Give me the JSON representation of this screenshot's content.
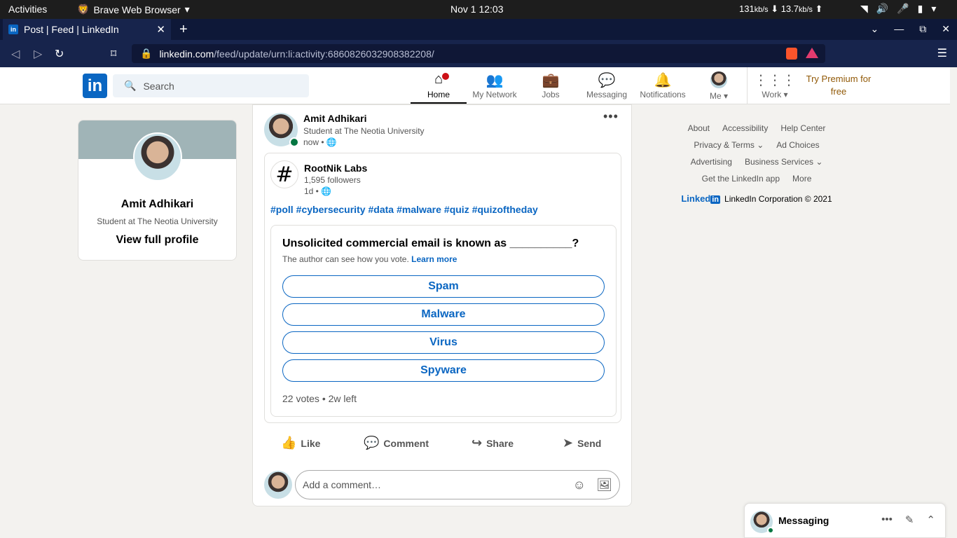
{
  "system": {
    "activities": "Activities",
    "app_name": "Brave Web Browser",
    "clock": "Nov 1  12:03",
    "down_speed": "131",
    "down_unit": "kb/s",
    "up_speed": "13.7",
    "up_unit": "kb/s"
  },
  "browser": {
    "tab_title": "Post | Feed | LinkedIn",
    "url_host": "linkedin.com",
    "url_path": "/feed/update/urn:li:activity:6860826032908382208/"
  },
  "linkedin": {
    "search_placeholder": "Search",
    "nav": {
      "home": "Home",
      "network": "My Network",
      "jobs": "Jobs",
      "messaging": "Messaging",
      "notifications": "Notifications",
      "me": "Me",
      "work": "Work"
    },
    "premium": "Try Premium for free"
  },
  "profile": {
    "name": "Amit Adhikari",
    "headline": "Student at The Neotia University",
    "view_profile": "View full profile"
  },
  "post": {
    "author": "Amit Adhikari",
    "headline": "Student at The Neotia University",
    "time": "now •",
    "shared": {
      "org": "RootNik Labs",
      "followers": "1,595 followers",
      "time": "1d •",
      "hashtags": [
        "#poll",
        "#cybersecurity",
        "#data",
        "#malware",
        "#quiz",
        "#quizoftheday"
      ],
      "poll": {
        "question": "Unsolicited commercial email is known as __________?",
        "note": "The author can see how you vote.",
        "learn_more": "Learn more",
        "options": [
          "Spam",
          "Malware",
          "Virus",
          "Spyware"
        ],
        "stats": "22 votes • 2w left"
      }
    },
    "actions": {
      "like": "Like",
      "comment": "Comment",
      "share": "Share",
      "send": "Send"
    },
    "comment_placeholder": "Add a comment…"
  },
  "footer": {
    "about": "About",
    "accessibility": "Accessibility",
    "help": "Help Center",
    "privacy": "Privacy & Terms",
    "ad_choices": "Ad Choices",
    "advertising": "Advertising",
    "business": "Business Services",
    "app": "Get the LinkedIn app",
    "more": "More",
    "brand": "Linked",
    "brand_in": "in",
    "copyright": "LinkedIn Corporation © 2021"
  },
  "messaging": {
    "title": "Messaging"
  },
  "colors": {
    "linkedin_blue": "#0a66c2",
    "brave_bar": "#17244c",
    "premium_gold": "#915907"
  }
}
